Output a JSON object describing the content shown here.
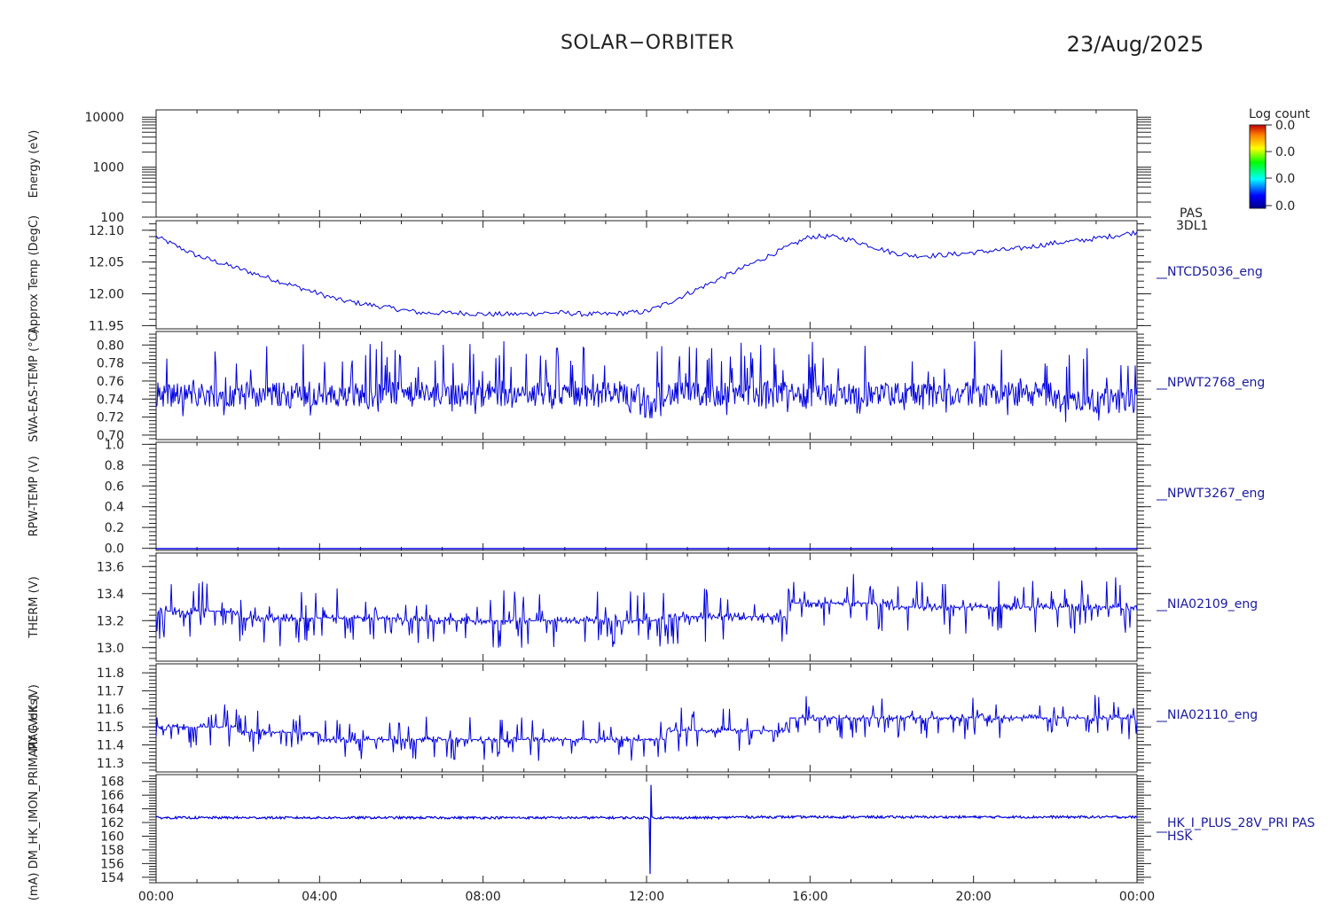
{
  "header": {
    "title": "SOLAR−ORBITER",
    "date": "23/Aug/2025"
  },
  "colorbar": {
    "title": "Log count",
    "ticks": [
      "0.0",
      "0.0",
      "0.0",
      "0.0"
    ]
  },
  "y_axis_labels": [
    "Energy (eV)",
    "Approx Temp (DegC)",
    "SWA-EAS-TEMP (°C)",
    "RPW-TEMP (V)",
    "THERM (V)",
    "MAG HK (V)",
    "(mA) DM_HK_IMON_PRIMARY (Volts)"
  ],
  "chart_data": [
    {
      "type": "heatmap",
      "name": "PAS 3DL1",
      "right_label": [
        "PAS",
        "3DL1"
      ],
      "yscale": "log",
      "ylim": [
        100,
        14000
      ],
      "yticks": [
        100,
        1000,
        10000
      ],
      "ytick_labels": [
        "100",
        "1000",
        "10000"
      ],
      "values": []
    },
    {
      "type": "line",
      "name": "NTCD5036_eng",
      "right_label": [
        "NTCD5036_eng"
      ],
      "ylim": [
        11.945,
        12.115
      ],
      "yticks": [
        11.95,
        12.0,
        12.05,
        12.1
      ],
      "ytick_labels": [
        "11.95",
        "12.00",
        "12.05",
        "12.10"
      ],
      "x": [
        0,
        0.5,
        1,
        1.5,
        2,
        2.5,
        3,
        3.5,
        4,
        4.5,
        5,
        5.5,
        6,
        6.5,
        7,
        7.5,
        8,
        8.5,
        9,
        9.5,
        10,
        10.5,
        11,
        11.5,
        12,
        12.5,
        13,
        13.5,
        14,
        14.5,
        15,
        15.5,
        16,
        16.5,
        17,
        17.5,
        18,
        18.5,
        19,
        19.5,
        20,
        20.5,
        21,
        21.5,
        22,
        22.5,
        23,
        23.5,
        24
      ],
      "values": [
        12.09,
        12.075,
        12.06,
        12.05,
        12.04,
        12.03,
        12.02,
        12.01,
        12.0,
        11.99,
        11.985,
        11.98,
        11.975,
        11.97,
        11.97,
        11.97,
        11.968,
        11.968,
        11.968,
        11.97,
        11.97,
        11.968,
        11.968,
        11.97,
        11.972,
        11.985,
        12.0,
        12.015,
        12.03,
        12.045,
        12.06,
        12.075,
        12.09,
        12.09,
        12.085,
        12.075,
        12.065,
        12.06,
        12.06,
        12.062,
        12.065,
        12.068,
        12.07,
        12.075,
        12.08,
        12.083,
        12.087,
        12.092,
        12.097
      ]
    },
    {
      "type": "line",
      "name": "NPWT2768_eng",
      "right_label": [
        "NPWT2768_eng"
      ],
      "ylim": [
        0.695,
        0.815
      ],
      "yticks": [
        0.7,
        0.72,
        0.74,
        0.76,
        0.78,
        0.8
      ],
      "ytick_labels": [
        "0.70",
        "0.72",
        "0.74",
        "0.76",
        "0.78",
        "0.80"
      ],
      "mean": 0.745,
      "range": [
        0.71,
        0.81
      ],
      "dip_at": 12.1
    },
    {
      "type": "line",
      "name": "NPWT3267_eng",
      "right_label": [
        "NPWT3267_eng"
      ],
      "ylim": [
        -0.02,
        1.02
      ],
      "yticks": [
        0.0,
        0.2,
        0.4,
        0.6,
        0.8,
        1.0
      ],
      "ytick_labels": [
        "0.0",
        "0.2",
        "0.4",
        "0.6",
        "0.8",
        "1.0"
      ],
      "mean": 0.0
    },
    {
      "type": "line",
      "name": "NIA02109_eng",
      "right_label": [
        "NIA02109_eng"
      ],
      "ylim": [
        12.9,
        13.7
      ],
      "yticks": [
        13.0,
        13.2,
        13.4,
        13.6
      ],
      "ytick_labels": [
        "13.0",
        "13.2",
        "13.4",
        "13.6"
      ],
      "levels": [
        {
          "from": 0,
          "to": 2,
          "mean": 13.27
        },
        {
          "from": 2,
          "to": 6,
          "mean": 13.22
        },
        {
          "from": 6,
          "to": 12.5,
          "mean": 13.2
        },
        {
          "from": 12.5,
          "to": 15.5,
          "mean": 13.23
        },
        {
          "from": 15.5,
          "to": 18,
          "mean": 13.33
        },
        {
          "from": 18,
          "to": 24,
          "mean": 13.3
        }
      ]
    },
    {
      "type": "line",
      "name": "NIA02110_eng",
      "right_label": [
        "NIA02110_eng"
      ],
      "ylim": [
        11.25,
        11.85
      ],
      "yticks": [
        11.3,
        11.4,
        11.5,
        11.6,
        11.7,
        11.8
      ],
      "ytick_labels": [
        "11.3",
        "11.4",
        "11.5",
        "11.6",
        "11.7",
        "11.8"
      ],
      "levels": [
        {
          "from": 0,
          "to": 2,
          "mean": 11.5
        },
        {
          "from": 2,
          "to": 4,
          "mean": 11.47
        },
        {
          "from": 4,
          "to": 12.5,
          "mean": 11.43
        },
        {
          "from": 12.5,
          "to": 15.5,
          "mean": 11.48
        },
        {
          "from": 15.5,
          "to": 24,
          "mean": 11.55
        }
      ]
    },
    {
      "type": "line",
      "name": "HK_I_PLUS_28V_PRI PAS HSK",
      "right_label": [
        "HK_I_PLUS_28V_PRI PAS",
        "HSK"
      ],
      "ylim": [
        153.2,
        169
      ],
      "yticks": [
        154,
        156,
        158,
        160,
        162,
        164,
        166,
        168
      ],
      "ytick_labels": [
        "154",
        "156",
        "158",
        "160",
        "162",
        "164",
        "166",
        "168"
      ],
      "mean": 162.7,
      "spike": {
        "at": 12.1,
        "min": 154.5,
        "max": 167.5
      }
    }
  ],
  "x_axis": {
    "range": [
      0,
      24
    ],
    "ticks": [
      0,
      4,
      8,
      12,
      16,
      20,
      24
    ],
    "tick_labels": [
      "00:00",
      "04:00",
      "08:00",
      "12:00",
      "16:00",
      "20:00",
      "00:00"
    ]
  }
}
